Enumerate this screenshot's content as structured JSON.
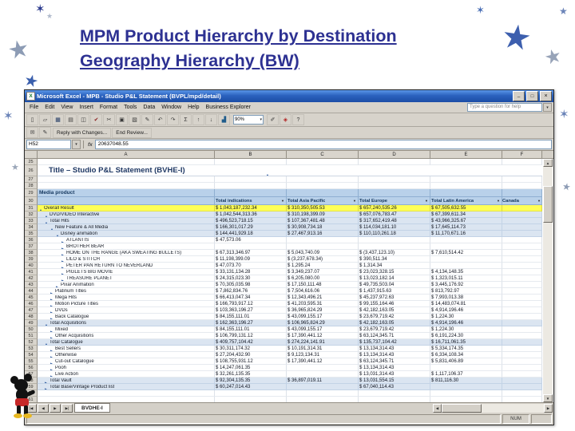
{
  "slide": {
    "title_line1": "MPM Product Hierarchy by Destination",
    "title_line2": "Geography Hierarchy (BW)"
  },
  "colors": {
    "title_text": "#2d3192",
    "titlebar_blue": "#2b62be",
    "highlight_row": "#ffff55",
    "group_row": "#dbe5f1",
    "header_fill": "#b9d1ea"
  },
  "excel": {
    "window_title": "Microsoft Excel - MPB - Studio P&L Statement (BVPL/mpd/detail)",
    "menus": [
      "File",
      "Edit",
      "View",
      "Insert",
      "Format",
      "Tools",
      "Data",
      "Window",
      "Help",
      "Business Explorer"
    ],
    "help_text": "Type a question for help",
    "toolbar_icons_left": [
      "new",
      "open",
      "save",
      "print",
      "print-preview",
      "spelling",
      "cut",
      "copy",
      "paste",
      "format-painter",
      "undo",
      "redo",
      "autosum",
      "sort-ascending",
      "sort-descending",
      "chart-wizard"
    ],
    "zoom": "90%",
    "toolbar_icons_right": [
      "drawing",
      "business-explorer",
      "help"
    ],
    "review_icons": [
      "envelope",
      "edit"
    ],
    "review_buttons": [
      "Reply with Changes...",
      "End Review..."
    ],
    "name_box": "H52",
    "fx_label": "fx",
    "formula_value": "20637048.55",
    "column_letters": [
      "A",
      "B",
      "C",
      "D",
      "E",
      "F"
    ],
    "sheet_tab": "BVDHE-I",
    "status_num": "NUM",
    "sheet": {
      "title": "Title – Studio P&L Statement (BVHE-I)",
      "corner_header": "Media product",
      "columns": [
        "Total indications",
        "Total Asia Pacific",
        "Total Europe",
        "Total Latin America",
        "Canada"
      ],
      "rows": [
        {
          "n": 25,
          "type": "blank"
        },
        {
          "n": 26,
          "type": "title"
        },
        {
          "n": 27,
          "type": "blank"
        },
        {
          "n": 28,
          "type": "blank"
        },
        {
          "n": 29,
          "type": "band"
        },
        {
          "n": 30,
          "type": "cols"
        },
        {
          "n": 31,
          "type": "data",
          "style": "yellow",
          "lvl": 0,
          "arrow": "down",
          "label": "Overall Result",
          "v": [
            "$ 1,043,187,232.34",
            "$ 310,350,505.53",
            "$ 657,240,535.26",
            "$ 67,505,632.55"
          ]
        },
        {
          "n": 32,
          "type": "data",
          "style": "group",
          "lvl": 1,
          "arrow": "down",
          "label": "DVD/VIDEO Interactive",
          "v": [
            "$ 1,042,544,313.36",
            "$ 310,198,399.09",
            "$ 657,076,783.47",
            "$ 67,399,611.34"
          ]
        },
        {
          "n": 33,
          "type": "data",
          "style": "group",
          "lvl": 1,
          "arrow": "down",
          "label": "Total Hits",
          "v": [
            "$ 496,523,718.15",
            "$ 107,367,481.48",
            "$ 317,652,419.48",
            "$ 43,966,325.67"
          ]
        },
        {
          "n": 34,
          "type": "data",
          "style": "group",
          "lvl": 2,
          "arrow": "down",
          "label": "New Feature & All Media",
          "v": [
            "$ 166,301,017.29",
            "$ 30,908,734.18",
            "$ 114,034,181.10",
            "$ 17,645,114.73"
          ]
        },
        {
          "n": 35,
          "type": "data",
          "style": "group",
          "lvl": 3,
          "arrow": "down",
          "label": "Disney animation",
          "v": [
            "$ 144,441,929.18",
            "$ 27,467,913.16",
            "$ 110,110,261.18",
            "$ 11,170,671.16"
          ]
        },
        {
          "n": 36,
          "type": "data",
          "style": "plain",
          "lvl": 4,
          "arrow": "right",
          "label": "ATLANTIS",
          "v": [
            "$ 47,573.06",
            "",
            "",
            ""
          ]
        },
        {
          "n": 37,
          "type": "data",
          "style": "plain",
          "lvl": 4,
          "arrow": "right",
          "label": "BROTHER BEAR",
          "v": [
            "",
            "",
            "",
            ""
          ]
        },
        {
          "n": 38,
          "type": "data",
          "style": "plain",
          "lvl": 4,
          "arrow": "right",
          "label": "HOME ON THE RANGE (AKA SWEATING BULLETS)",
          "v": [
            "$ 67,313,346.97",
            "$ 5,043,740.09",
            "$ (3,437,123.10)",
            "$ 7,610,514.42"
          ]
        },
        {
          "n": 39,
          "type": "data",
          "style": "plain",
          "lvl": 4,
          "arrow": "right",
          "label": "LILO & STITCH",
          "v": [
            "$ 11,198,399.09",
            "$ (3,237,678.34)",
            "$ 390,511.34",
            ""
          ]
        },
        {
          "n": 40,
          "type": "data",
          "style": "plain",
          "lvl": 4,
          "arrow": "right",
          "label": "PETER PAN RETURN TO NEVERLAND",
          "v": [
            "$ 47,073.70",
            "$ 1,295.24",
            "$ 1,314.34",
            ""
          ]
        },
        {
          "n": 41,
          "type": "data",
          "style": "plain",
          "lvl": 4,
          "arrow": "right",
          "label": "PIGLETS BIG MOVIE",
          "v": [
            "$ 33,131,134.28",
            "$ 3,349,237.07",
            "$ 23,023,328.15",
            "$ 4,134,148.35"
          ]
        },
        {
          "n": 42,
          "type": "data",
          "style": "plain",
          "lvl": 4,
          "arrow": "right",
          "label": "TREASURE PLANET",
          "v": [
            "$ 24,315,023.30",
            "$ 6,205,080.00",
            "$ 13,023,182.14",
            "$ 1,323,015.11"
          ]
        },
        {
          "n": 43,
          "type": "data",
          "style": "plain",
          "lvl": 3,
          "arrow": "right",
          "label": "Pixar Animation",
          "v": [
            "$ 70,305,035.98",
            "$ 17,150,111.48",
            "$ 49,735,503.04",
            "$ 3,445,176.92"
          ]
        },
        {
          "n": 44,
          "type": "data",
          "style": "plain",
          "lvl": 2,
          "arrow": "right",
          "label": "Platinum Titles",
          "v": [
            "$ 7,862,834.76",
            "$ 7,504,616.06",
            "$ 1,437,915.63",
            "$ 813,792.97"
          ]
        },
        {
          "n": 45,
          "type": "data",
          "style": "plain",
          "lvl": 2,
          "arrow": "right",
          "label": "Mega Hits",
          "v": [
            "$ 66,413,047.34",
            "$ 12,343,496.21",
            "$ 45,237,972.63",
            "$ 7,993,013.38"
          ]
        },
        {
          "n": 46,
          "type": "data",
          "style": "plain",
          "lvl": 2,
          "arrow": "right",
          "label": "Motion Picture Titles",
          "v": [
            "$ 166,793,917.12",
            "$ 41,203,595.31",
            "$ 99,155,164.46",
            "$ 14,483,074.81"
          ]
        },
        {
          "n": 47,
          "type": "data",
          "style": "plain",
          "lvl": 2,
          "arrow": "right",
          "label": "DVDs",
          "v": [
            "$ 103,363,196.27",
            "$ 36,965,824.29",
            "$ 42,182,163.05",
            "$ 4,914,196.46"
          ]
        },
        {
          "n": 48,
          "type": "data",
          "style": "plain",
          "lvl": 2,
          "arrow": "right",
          "label": "Back Catalogue",
          "v": [
            "$ 84,155,111.01",
            "$ 43,099,155.17",
            "$ 23,679,719.42",
            "$ 1,224.30"
          ]
        },
        {
          "n": 49,
          "type": "data",
          "style": "group",
          "lvl": 1,
          "arrow": "down",
          "label": "Total Acquisitions",
          "v": [
            "$ 162,363,196.27",
            "$ 106,965,824.29",
            "$ 42,182,163.05",
            "$ 4,914,196.46"
          ]
        },
        {
          "n": 50,
          "type": "data",
          "style": "plain",
          "lvl": 2,
          "arrow": "right",
          "label": "Mixed",
          "v": [
            "$ 84,155,111.01",
            "$ 43,099,155.17",
            "$ 23,679,719.42",
            "$ 1,224.30"
          ]
        },
        {
          "n": 51,
          "type": "data",
          "style": "plain",
          "lvl": 2,
          "arrow": "right",
          "label": "Other Acquisitions",
          "v": [
            "$ 106,799,131.12",
            "$ 17,390,441.12",
            "$ 63,124,345.71",
            "$ 6,191,224.30"
          ]
        },
        {
          "n": 52,
          "type": "data",
          "style": "group",
          "lvl": 1,
          "arrow": "down",
          "label": "Total Catalogue",
          "v": [
            "$ 409,757,104.42",
            "$ 274,224,141.91",
            "$ 135,737,104.42",
            "$ 16,711,061.35"
          ]
        },
        {
          "n": 53,
          "type": "data",
          "style": "plain",
          "lvl": 2,
          "arrow": "right",
          "label": "Best Sellers",
          "v": [
            "$ 30,311,174.32",
            "$ 10,191,314.31",
            "$ 13,134,314.43",
            "$ 5,334,174.35"
          ]
        },
        {
          "n": 54,
          "type": "data",
          "style": "plain",
          "lvl": 2,
          "arrow": "right",
          "label": "Otherwise",
          "v": [
            "$ 27,204,432.90",
            "$ 9,123,134.31",
            "$ 13,134,314.43",
            "$ 6,334,108.34"
          ]
        },
        {
          "n": 55,
          "type": "data",
          "style": "plain",
          "lvl": 2,
          "arrow": "right",
          "label": "Cut-out Catalogue",
          "v": [
            "$ 108,755,931.12",
            "$ 17,390,441.12",
            "$ 63,124,345.71",
            "$ 5,831,406.89"
          ]
        },
        {
          "n": 56,
          "type": "data",
          "style": "plain",
          "lvl": 2,
          "arrow": "right",
          "label": "Pooh",
          "v": [
            "$ 14,247,061.35",
            "",
            "$ 13,134,314.43",
            ""
          ]
        },
        {
          "n": 57,
          "type": "data",
          "style": "plain",
          "lvl": 2,
          "arrow": "right",
          "label": "Live Action",
          "v": [
            "$ 32,261,135.35",
            "",
            "$ 13,031,314.43",
            "$ 1,117,106.37"
          ]
        },
        {
          "n": 58,
          "type": "data",
          "style": "group",
          "lvl": 1,
          "arrow": "right",
          "label": "Total Vault",
          "v": [
            "$ 92,304,135.35",
            "$ 36,897,019.11",
            "$ 13,031,554.15",
            "$ 811,116.30"
          ]
        },
        {
          "n": 59,
          "type": "data",
          "style": "group",
          "lvl": 1,
          "arrow": "right",
          "label": "Total Base/Vintage Product list",
          "v": [
            "$ 60,247,014.43",
            "",
            "$ 67,040,114.43",
            ""
          ]
        },
        {
          "n": 60,
          "type": "blank"
        },
        {
          "n": 61,
          "type": "blank"
        }
      ]
    }
  }
}
